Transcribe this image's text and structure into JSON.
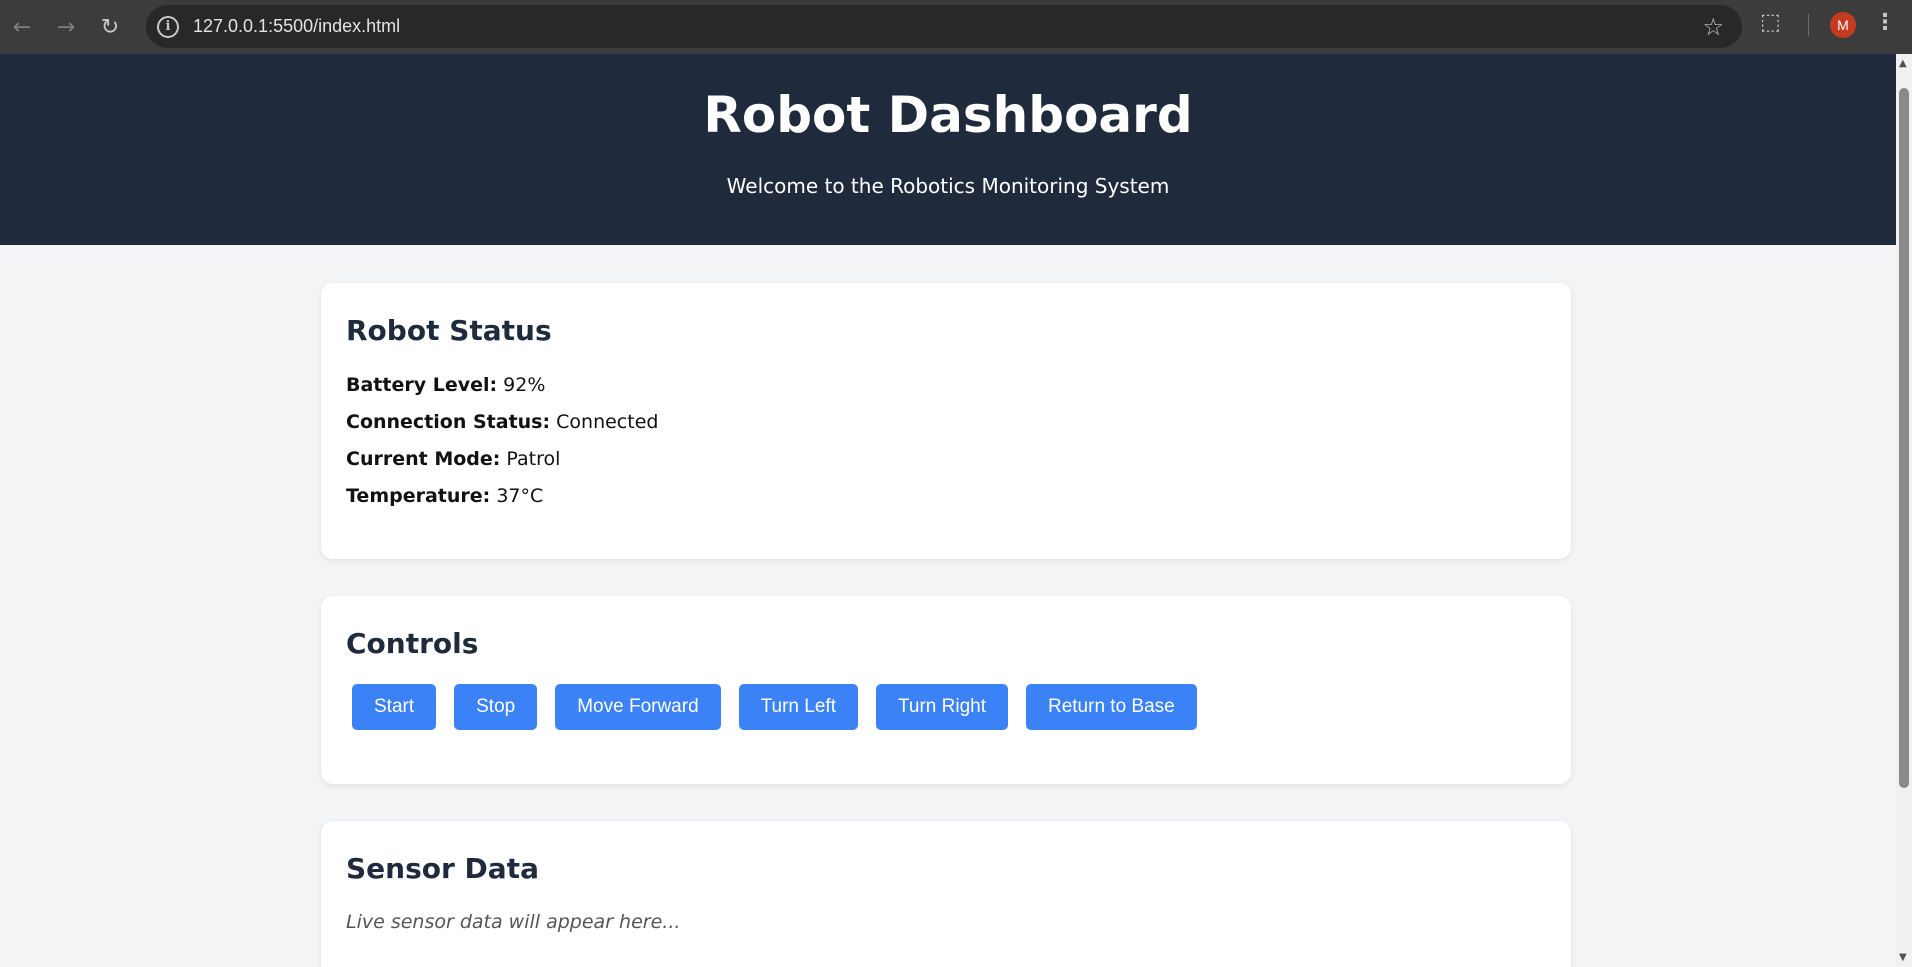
{
  "browser": {
    "url": "127.0.0.1:5500/index.html",
    "back_icon": "←",
    "forward_icon": "→",
    "reload_icon": "↻",
    "info_icon": "i",
    "star_icon": "☆",
    "extensions_icon": "⬚",
    "profile_initial": "M",
    "menu_icon": "⋮"
  },
  "header": {
    "title": "Robot Dashboard",
    "subtitle": "Welcome to the Robotics Monitoring System"
  },
  "status": {
    "heading": "Robot Status",
    "items": [
      {
        "label": "Battery Level:",
        "value": "92%"
      },
      {
        "label": "Connection Status:",
        "value": "Connected"
      },
      {
        "label": "Current Mode:",
        "value": "Patrol"
      },
      {
        "label": "Temperature:",
        "value": "37°C"
      }
    ]
  },
  "controls": {
    "heading": "Controls",
    "buttons": [
      "Start",
      "Stop",
      "Move Forward",
      "Turn Left",
      "Turn Right",
      "Return to Base"
    ]
  },
  "sensors": {
    "heading": "Sensor Data",
    "placeholder": "Live sensor data will appear here..."
  },
  "colors": {
    "header_bg": "#1f2a3c",
    "accent": "#3b82f6",
    "page_bg": "#f3f4f6"
  }
}
